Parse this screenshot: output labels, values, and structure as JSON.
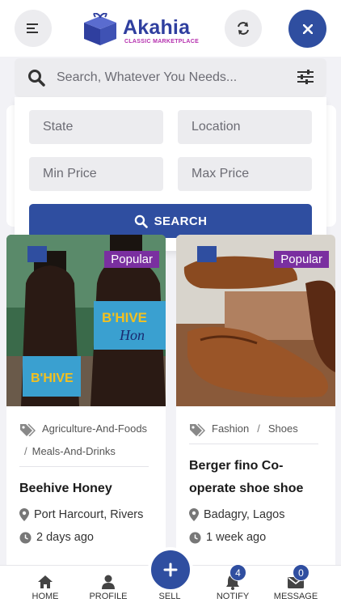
{
  "brand": {
    "name": "Akahia",
    "tagline": "CLASSIC MARKETPLACE"
  },
  "search": {
    "placeholder": "Search, Whatever You Needs..."
  },
  "filters": {
    "state_placeholder": "State",
    "location_placeholder": "Location",
    "min_price_placeholder": "Min Price",
    "max_price_placeholder": "Max Price",
    "search_label": "SEARCH"
  },
  "products": [
    {
      "badge": "Popular",
      "category_1": "Agriculture-And-Foods",
      "separator": "/",
      "category_2": "Meals-And-Drinks",
      "title": "Beehive Honey",
      "location": "Port Harcourt, Rivers",
      "posted": "2 days ago"
    },
    {
      "badge": "Popular",
      "category_1": "Fashion",
      "separator": "/",
      "category_2": "Shoes",
      "title": "Berger fino Co-operate shoe shoe",
      "location": "Badagry, Lagos",
      "posted": "1 week ago"
    }
  ],
  "nav": {
    "home": "HOME",
    "profile": "PROFILE",
    "sell": "SELL",
    "notify": "NOTIFY",
    "notify_count": "4",
    "message": "MESSAGE",
    "message_count": "0"
  },
  "colors": {
    "primary": "#2f4ea0",
    "badge": "#7a2fa0",
    "field_bg": "#ececef"
  },
  "icons": [
    "menu-icon",
    "refresh-icon",
    "close-icon",
    "search-icon",
    "filter-icon",
    "tag-icon",
    "location-icon",
    "clock-icon",
    "home-icon",
    "profile-icon",
    "plus-icon",
    "bell-icon",
    "mail-icon"
  ]
}
